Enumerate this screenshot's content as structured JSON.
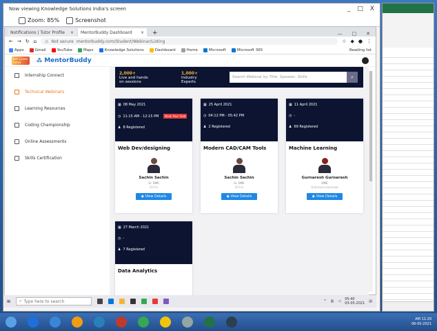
{
  "outer_window": {
    "title": "Now viewing Knowledge Solutions India's screen",
    "zoom_label": "Zoom: 85%",
    "screenshot_label": "Screenshot",
    "min": "_",
    "restore": "□",
    "close": "X"
  },
  "browser": {
    "tabs": [
      {
        "label": "Notifications | Tutor Profile"
      },
      {
        "label": "MentorBuddy Dashboard"
      }
    ],
    "new_tab": "+",
    "url": "mentorbuddy.com/Student/Webinar/Listing",
    "secure_label": "Not secure",
    "bookmarks": [
      "Apps",
      "Gmail",
      "YouTube",
      "Maps",
      "Knowledge Solutions",
      "Dashboard",
      "Home",
      "Microsoft",
      "Microsoft 365"
    ],
    "reading_list": "Reading list"
  },
  "site": {
    "logo_text": "Tech Career Trainer",
    "brand": "MentorBuddy"
  },
  "sidebar": {
    "items": [
      {
        "label": "Internship Connect",
        "active": false
      },
      {
        "label": "Technical Webinars",
        "active": true
      },
      {
        "label": "Learning Resources",
        "active": false
      },
      {
        "label": "Coding Championship",
        "active": false
      },
      {
        "label": "Online Assessments",
        "active": false
      },
      {
        "label": "Skills Certification",
        "active": false
      }
    ]
  },
  "banner": {
    "stat1_value": "2,000+",
    "stat1_label": "Live and hands on sessions",
    "stat2_value": "1,000+",
    "stat2_label": "Industry Experts",
    "search_placeholder": "Search Webinar by Title, Speaker, Skills",
    "search_icon": "search-icon"
  },
  "webinars": [
    {
      "date": "08 May 2021",
      "time": "11:15 AM - 12:15 PM",
      "live_badge": "Book Your Seat",
      "registered": "8 Registered",
      "title": "Web Dev/designing",
      "mentor_name": "Sachin Sachin",
      "mentor_role": "Sr. DME",
      "mentor_company": "10 hrs",
      "button": "View Details"
    },
    {
      "date": "25 April 2021",
      "time": "04:12 PM - 05:42 PM",
      "live_badge": "",
      "registered": "2 Registered",
      "title": "Modern CAD/CAM Tools",
      "mentor_name": "Sachin Sachin",
      "mentor_role": "Sr. DME",
      "mentor_company": "10 hrs",
      "button": "View Details"
    },
    {
      "date": "11 April 2021",
      "time": "-",
      "live_badge": "",
      "registered": "69 Registered",
      "title": "Machine Learning",
      "mentor_name": "Gurnaresh Gurnaresh",
      "mentor_role": "DME",
      "mentor_company": "Quantum Learnings",
      "button": "View Details"
    },
    {
      "date": "27 March 2021",
      "time": "-",
      "live_badge": "",
      "registered": "7 Registered",
      "title": "Data Analytics",
      "mentor_name": "",
      "mentor_role": "",
      "mentor_company": "",
      "button": ""
    }
  ],
  "inner_taskbar": {
    "search_placeholder": "Type here to search",
    "time": "05:40",
    "date": "03-05-2021"
  },
  "host_taskbar": {
    "time": "AM 11:29",
    "date": "06-05-2021"
  },
  "colors": {
    "dark_navy": "#0c1431",
    "accent_orange": "#e8791f",
    "button_blue": "#1e88e5",
    "live_red": "#e53935",
    "stat_yellow": "#f9b233"
  }
}
